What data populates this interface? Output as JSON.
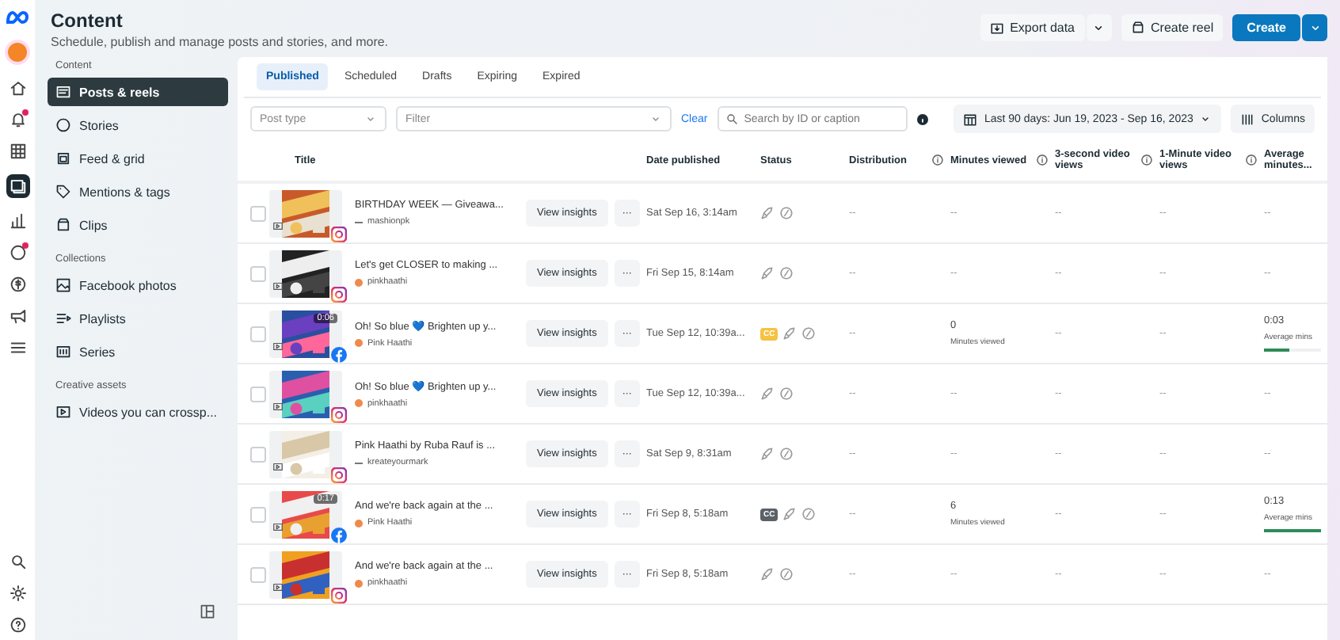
{
  "header": {
    "title": "Content",
    "subtitle": "Schedule, publish and manage posts and stories, and more.",
    "buttons": [
      {
        "label": "Export data",
        "kind": "split"
      },
      {
        "label": "Create reel",
        "kind": "plain"
      },
      {
        "label": "Create",
        "kind": "primary"
      }
    ]
  },
  "sidebar": {
    "sections": [
      {
        "title": "Content",
        "items": [
          {
            "label": "Posts & reels",
            "selected": true
          },
          {
            "label": "Stories",
            "selected": false
          },
          {
            "label": "Feed & grid",
            "selected": false
          },
          {
            "label": "Mentions & tags",
            "selected": false
          },
          {
            "label": "Clips",
            "selected": false
          }
        ]
      },
      {
        "title": "Collections",
        "items": [
          {
            "label": "Facebook photos",
            "selected": false
          },
          {
            "label": "Playlists",
            "selected": false
          },
          {
            "label": "Series",
            "selected": false
          }
        ]
      },
      {
        "title": "Creative assets",
        "items": [
          {
            "label": "Videos you can crossp...",
            "selected": false
          }
        ]
      }
    ]
  },
  "tabs": [
    {
      "label": "Published",
      "selected": true
    },
    {
      "label": "Scheduled",
      "selected": false
    },
    {
      "label": "Drafts",
      "selected": false
    },
    {
      "label": "Expiring",
      "selected": false
    },
    {
      "label": "Expired",
      "selected": false
    }
  ],
  "filters": {
    "post_type": {
      "placeholder": "Post type"
    },
    "filter": {
      "placeholder": "Filter"
    },
    "clear": "Clear",
    "search": {
      "placeholder": "Search by ID or caption"
    },
    "date_range": "Last 90 days: Jun 19, 2023 - Sep 16, 2023",
    "columns": "Columns"
  },
  "table": {
    "columns": [
      {
        "label": "Title",
        "info": false
      },
      {
        "label": "Date published",
        "info": false
      },
      {
        "label": "Status",
        "info": false
      },
      {
        "label": "Distribution",
        "info": true
      },
      {
        "label": "Minutes viewed",
        "info": true
      },
      {
        "label": "3-second video views",
        "info": true
      },
      {
        "label": "1-Minute video views",
        "info": true
      },
      {
        "label": "Average minutes...",
        "info": false
      }
    ],
    "rows": [
      {
        "checked": false,
        "title": "BIRTHDAY WEEK — Giveawa...",
        "account": "mashionpk",
        "avatar": {
          "kind": "dash"
        },
        "platform": {
          "kind": "instagram"
        },
        "action": "View insights",
        "more": "···",
        "date": "Sat Sep 16, 3:14am",
        "distribution": "--",
        "minutes": "--",
        "three_sec": "--",
        "one_min": "--",
        "avg": "--"
      },
      {
        "checked": false,
        "title": "Let's get CLOSER to making ...",
        "account": "pinkhaathi",
        "avatar": {
          "kind": "dot"
        },
        "platform": {
          "kind": "instagram"
        },
        "action": "View insights",
        "more": "···",
        "date": "Fri Sep 15, 8:14am",
        "distribution": "--",
        "minutes": "--",
        "three_sec": "--",
        "one_min": "--",
        "avg": "--"
      },
      {
        "checked": false,
        "title": "Oh! So blue 💙 Brighten up y...",
        "account": "Pink Haathi",
        "avatar": {
          "kind": "dot"
        },
        "platform": {
          "kind": "facebook"
        },
        "duration": "0:06",
        "action": "View insights",
        "more": "···",
        "date": "Tue Sep 12, 10:39a...",
        "captions": {
          "label": "CC",
          "kind": "pending"
        },
        "distribution": "--",
        "minutes": "0",
        "minutes_label": "Minutes viewed",
        "three_sec": "--",
        "one_min": "--",
        "avg": "0:03",
        "avg_label": "Average mins",
        "level": 0.45
      },
      {
        "checked": false,
        "title": "Oh! So blue 💙 Brighten up y...",
        "account": "pinkhaathi",
        "avatar": {
          "kind": "dot"
        },
        "platform": {
          "kind": "instagram"
        },
        "action": "View insights",
        "more": "···",
        "date": "Tue Sep 12, 10:39a...",
        "distribution": "--",
        "minutes": "--",
        "three_sec": "--",
        "one_min": "--",
        "avg": "--"
      },
      {
        "checked": false,
        "title": "Pink Haathi by Ruba Rauf is ...",
        "account": "kreateyourmark",
        "avatar": {
          "kind": "dash"
        },
        "platform": {
          "kind": "instagram"
        },
        "action": "View insights",
        "more": "···",
        "date": "Sat Sep 9, 8:31am",
        "distribution": "--",
        "minutes": "--",
        "three_sec": "--",
        "one_min": "--",
        "avg": "--"
      },
      {
        "checked": false,
        "title": "And we're back again at the ...",
        "account": "Pink Haathi",
        "avatar": {
          "kind": "dot"
        },
        "platform": {
          "kind": "facebook"
        },
        "duration": "0:17",
        "action": "View insights",
        "more": "···",
        "date": "Fri Sep 8, 5:18am",
        "captions": {
          "label": "CC",
          "kind": "ready"
        },
        "distribution": "--",
        "minutes": "6",
        "minutes_label": "Minutes viewed",
        "three_sec": "--",
        "one_min": "--",
        "avg": "0:13",
        "avg_label": "Average mins",
        "level": 1.0
      },
      {
        "checked": false,
        "title": "And we're back again at the ...",
        "account": "pinkhaathi",
        "avatar": {
          "kind": "dot"
        },
        "platform": {
          "kind": "instagram"
        },
        "action": "View insights",
        "more": "···",
        "date": "Fri Sep 8, 5:18am",
        "distribution": "--",
        "minutes": "--",
        "three_sec": "--",
        "one_min": "--",
        "avg": "--"
      }
    ]
  }
}
